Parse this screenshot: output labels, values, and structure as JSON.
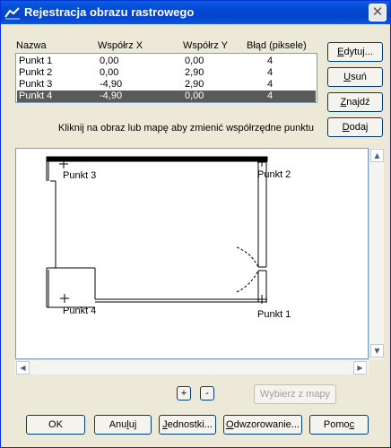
{
  "window": {
    "title": "Rejestracja obrazu rastrowego",
    "close_glyph": "✕"
  },
  "table": {
    "headers": [
      "Nazwa",
      "Współrz X",
      "Współrz Y",
      "Błąd (piksele)"
    ],
    "rows": [
      [
        "Punkt 1",
        "0,00",
        "0,00",
        "4"
      ],
      [
        "Punkt 2",
        "0,00",
        "2,90",
        "4"
      ],
      [
        "Punkt 3",
        "-4,90",
        "2,90",
        "4"
      ],
      [
        "Punkt 4",
        "-4,90",
        "0,00",
        "4"
      ]
    ],
    "selected_index": 3
  },
  "side_buttons": {
    "edit": {
      "pre": "",
      "key": "E",
      "post": "dytuj..."
    },
    "remove": {
      "pre": "",
      "key": "U",
      "post": "suń"
    },
    "find": {
      "pre": "",
      "key": "Z",
      "post": "najdź"
    },
    "add": {
      "pre": "",
      "key": "D",
      "post": "odaj"
    }
  },
  "instruction": "Kliknij na obraz lub mapę aby zmienić współrzędne punktu",
  "points": {
    "p1": "Punkt 1",
    "p2": "Punkt 2",
    "p3": "Punkt 3",
    "p4": "Punkt 4"
  },
  "zoom": {
    "in": "+",
    "out": "-"
  },
  "choose_map": "Wybierz z mapy",
  "bottom_buttons": {
    "ok": "OK",
    "cancel": {
      "pre": "Anu",
      "key": "l",
      "post": "uj"
    },
    "units": {
      "pre": "",
      "key": "J",
      "post": "ednostki..."
    },
    "projection": {
      "pre": "",
      "key": "O",
      "post": "dwzorowanie..."
    },
    "help": {
      "pre": "Pomo",
      "key": "c",
      "post": ""
    }
  },
  "icons": {
    "window": "map-registration-icon",
    "close": "close-icon",
    "scroll_up": "scroll-up-arrow-icon",
    "scroll_down": "scroll-down-arrow-icon",
    "scroll_left": "scroll-left-arrow-icon",
    "scroll_right": "scroll-right-arrow-icon"
  }
}
